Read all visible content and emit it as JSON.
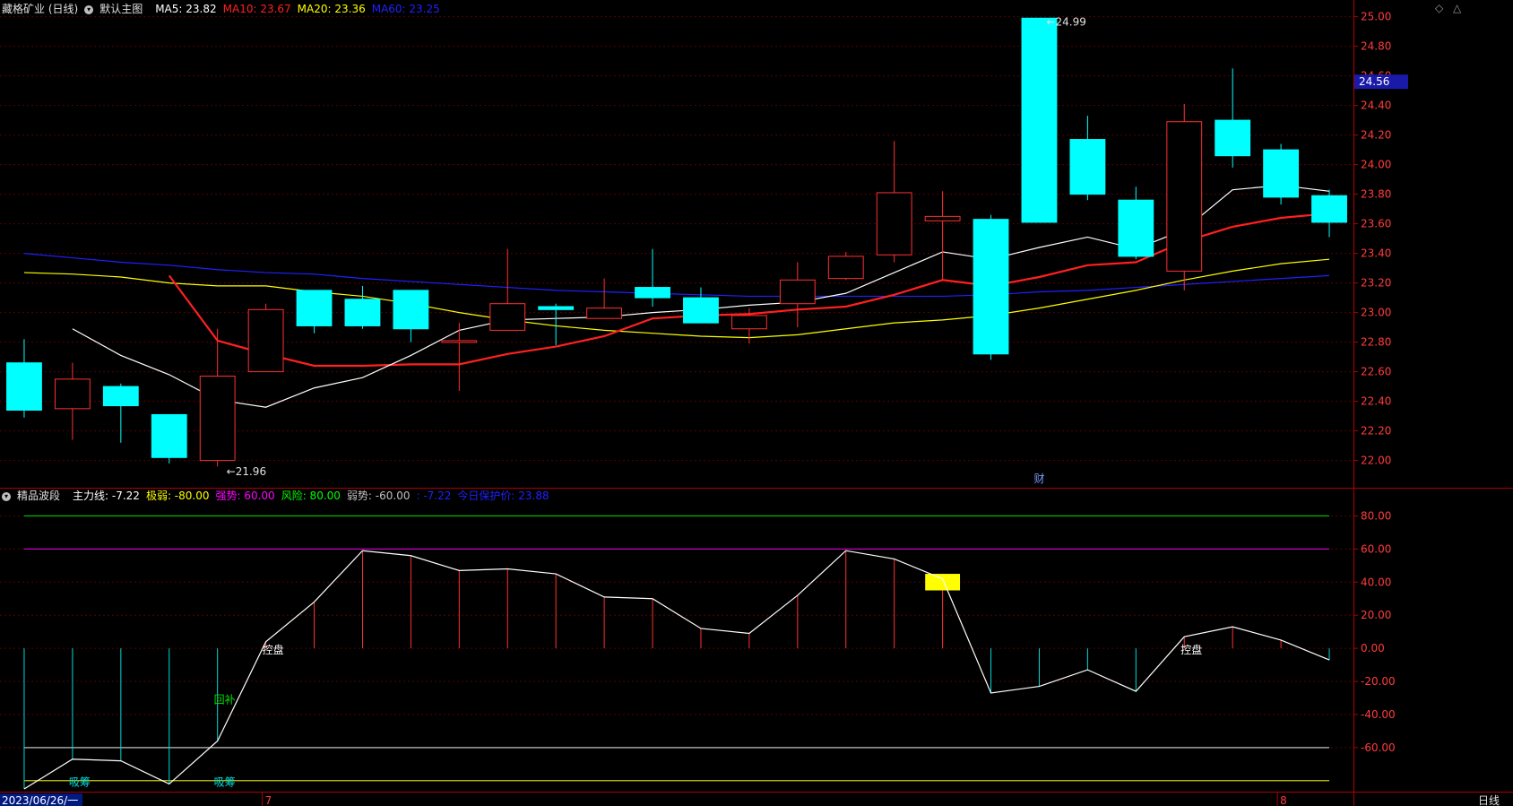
{
  "stock_title": "藏格矿业 (日线)",
  "main_menu_label": "默认主图",
  "ma": [
    {
      "label": "MA5: 23.82",
      "color": "#ffffff"
    },
    {
      "label": "MA10: 23.67",
      "color": "#ff2020"
    },
    {
      "label": "MA20: 23.36",
      "color": "#ffff00"
    },
    {
      "label": "MA60: 23.25",
      "color": "#2020ff"
    }
  ],
  "indicator": {
    "name": "精品波段",
    "items": [
      {
        "label": "主力线: -7.22",
        "color": "#ffffff"
      },
      {
        "label": "极弱: -80.00",
        "color": "#ffff00"
      },
      {
        "label": "强势: 60.00",
        "color": "#ff00ff"
      },
      {
        "label": "风险: 80.00",
        "color": "#00ff00"
      },
      {
        "label": "弱势: -60.00",
        "color": "#c0c0c0"
      },
      {
        "label": ": -7.22",
        "color": "#2020ff"
      },
      {
        "label": "今日保护价: 23.88",
        "color": "#2020ff"
      }
    ]
  },
  "colors": {
    "up": "#ff3030",
    "down": "#00ffff",
    "grid": "#5a0000",
    "axis_text": "#ff3c3c",
    "ma5": "#ffffff",
    "ma10": "#ff2020",
    "ma20": "#ffff00",
    "ma60": "#2020ff",
    "current_price_bg": "#1a1aa8"
  },
  "chart_data": {
    "type": "candlestick",
    "price_ticks": [
      "25.00",
      "24.80",
      "24.60",
      "24.40",
      "24.20",
      "24.00",
      "23.80",
      "23.60",
      "23.40",
      "23.20",
      "23.00",
      "22.80",
      "22.60",
      "22.40",
      "22.20",
      "22.00"
    ],
    "ylim": [
      21.84,
      25.04
    ],
    "current_price": "24.56",
    "high_label": "24.99",
    "low_label": "21.96",
    "event_label": "财",
    "candles": [
      {
        "o": 22.66,
        "c": 22.34,
        "h": 22.82,
        "l": 22.29
      },
      {
        "o": 22.35,
        "c": 22.55,
        "h": 22.66,
        "l": 22.14
      },
      {
        "o": 22.5,
        "c": 22.37,
        "h": 22.52,
        "l": 22.12
      },
      {
        "o": 22.31,
        "c": 22.02,
        "h": 22.31,
        "l": 21.98
      },
      {
        "o": 22.0,
        "c": 22.57,
        "h": 22.89,
        "l": 21.96
      },
      {
        "o": 22.6,
        "c": 23.02,
        "h": 23.06,
        "l": 22.6
      },
      {
        "o": 23.15,
        "c": 22.91,
        "h": 23.15,
        "l": 22.86
      },
      {
        "o": 23.09,
        "c": 22.91,
        "h": 23.18,
        "l": 22.89
      },
      {
        "o": 23.15,
        "c": 22.89,
        "h": 23.15,
        "l": 22.8
      },
      {
        "o": 22.81,
        "c": 22.81,
        "h": 22.93,
        "l": 22.47
      },
      {
        "o": 22.88,
        "c": 23.06,
        "h": 23.43,
        "l": 22.88
      },
      {
        "o": 23.04,
        "c": 23.02,
        "h": 23.06,
        "l": 22.78
      },
      {
        "o": 22.96,
        "c": 23.03,
        "h": 23.23,
        "l": 22.96
      },
      {
        "o": 23.17,
        "c": 23.1,
        "h": 23.43,
        "l": 23.04
      },
      {
        "o": 23.1,
        "c": 22.93,
        "h": 23.17,
        "l": 22.93
      },
      {
        "o": 22.89,
        "c": 22.98,
        "h": 23.03,
        "l": 22.79
      },
      {
        "o": 23.06,
        "c": 23.22,
        "h": 23.34,
        "l": 22.9
      },
      {
        "o": 23.23,
        "c": 23.38,
        "h": 23.41,
        "l": 23.22
      },
      {
        "o": 23.39,
        "c": 23.81,
        "h": 24.16,
        "l": 23.34
      },
      {
        "o": 23.62,
        "c": 23.65,
        "h": 23.82,
        "l": 23.22
      },
      {
        "o": 23.63,
        "c": 22.72,
        "h": 23.66,
        "l": 22.68
      },
      {
        "o": 24.99,
        "c": 23.61,
        "h": 24.99,
        "l": 23.61
      },
      {
        "o": 24.17,
        "c": 23.8,
        "h": 24.33,
        "l": 23.76
      },
      {
        "o": 23.76,
        "c": 23.38,
        "h": 23.85,
        "l": 23.36
      },
      {
        "o": 23.28,
        "c": 24.29,
        "h": 24.41,
        "l": 23.15
      },
      {
        "o": 24.3,
        "c": 24.06,
        "h": 24.65,
        "l": 23.98
      },
      {
        "o": 24.1,
        "c": 23.78,
        "h": 24.14,
        "l": 23.73
      },
      {
        "o": 23.79,
        "c": 23.61,
        "h": 23.83,
        "l": 23.51
      }
    ],
    "ma5": [
      22.89,
      22.71,
      22.58,
      22.41,
      22.36,
      22.49,
      22.56,
      22.71,
      22.88,
      22.95,
      22.96,
      22.97,
      23.0,
      23.02,
      23.05,
      23.07,
      23.13,
      23.27,
      23.41,
      23.36,
      23.44,
      23.51,
      23.43,
      23.56,
      23.83,
      23.86,
      23.82
    ],
    "ma10": [
      23.25,
      22.81,
      22.72,
      22.64,
      22.64,
      22.65,
      22.65,
      22.72,
      22.77,
      22.84,
      22.96,
      22.98,
      22.99,
      23.02,
      23.04,
      23.12,
      23.22,
      23.18,
      23.24,
      23.32,
      23.34,
      23.48,
      23.58,
      23.64,
      23.67
    ],
    "ma20": [
      23.27,
      23.26,
      23.24,
      23.2,
      23.18,
      23.18,
      23.14,
      23.11,
      23.06,
      23.0,
      22.95,
      22.91,
      22.88,
      22.86,
      22.84,
      22.83,
      22.85,
      22.89,
      22.93,
      22.95,
      22.98,
      23.03,
      23.09,
      23.15,
      23.22,
      23.28,
      23.33,
      23.36
    ],
    "ma60": [
      23.4,
      23.37,
      23.34,
      23.32,
      23.29,
      23.27,
      23.26,
      23.23,
      23.21,
      23.19,
      23.17,
      23.15,
      23.14,
      23.13,
      23.12,
      23.11,
      23.11,
      23.11,
      23.11,
      23.11,
      23.12,
      23.14,
      23.15,
      23.17,
      23.19,
      23.21,
      23.23,
      23.25
    ],
    "indicator_ticks": [
      "80.00",
      "60.00",
      "40.00",
      "20.00",
      "0.00",
      "-20.00",
      "-40.00",
      "-60.00"
    ],
    "indicator_ylim": [
      -85,
      90
    ],
    "main_line": [
      -85,
      -67,
      -68,
      -82,
      -56,
      4,
      28,
      59,
      56,
      47,
      48,
      45,
      31,
      30,
      12,
      9,
      32,
      59,
      54,
      42,
      -27,
      -23,
      -13,
      -26,
      7,
      13,
      5,
      -7
    ],
    "level_lines": [
      {
        "value": 80,
        "color": "#00c800"
      },
      {
        "value": 60,
        "color": "#c800c8"
      },
      {
        "value": -60,
        "color": "#c0c0c0"
      },
      {
        "value": -80,
        "color": "#c8c800"
      }
    ],
    "signals": [
      {
        "text": "控盘",
        "index": 5,
        "value": -1,
        "color": "#ffffff"
      },
      {
        "text": "控盘",
        "index": 24,
        "value": -1,
        "color": "#ffffff"
      },
      {
        "text": "回补",
        "index": 4,
        "value": -31,
        "color": "#00e000"
      },
      {
        "text": "吸筹",
        "index": 1,
        "value": -81,
        "color": "#00e0e0"
      },
      {
        "text": "吸筹",
        "index": 4,
        "value": -81,
        "color": "#00e0e0"
      }
    ],
    "highlight": {
      "index": 19,
      "from": 35,
      "to": 45,
      "color": "#ffff00"
    },
    "x_labels": [
      {
        "text": "2023/06/26/一",
        "index": 0
      },
      {
        "text": "7",
        "index": 5
      },
      {
        "text": "8",
        "index": 26
      }
    ],
    "period_label": "日线"
  }
}
